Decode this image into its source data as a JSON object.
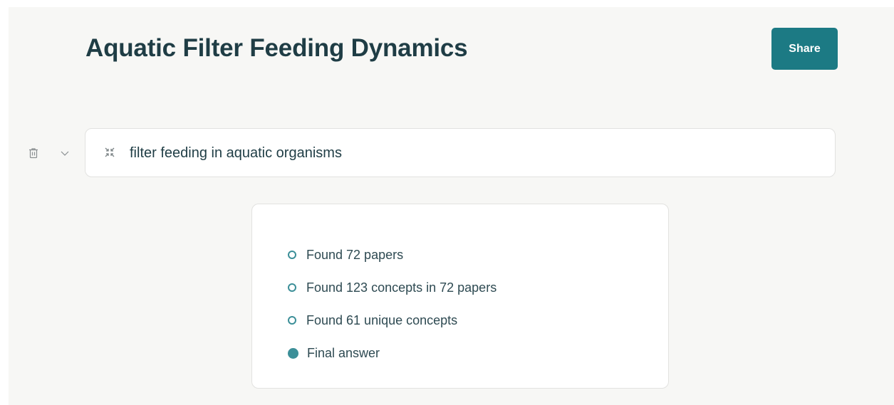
{
  "header": {
    "title": "Aquatic Filter Feeding Dynamics",
    "share_label": "Share"
  },
  "query": {
    "text": "filter feeding in aquatic organisms",
    "icon": "collapse-arrows-icon"
  },
  "row_tools": {
    "delete_icon": "trash-icon",
    "expand_icon": "chevron-down-icon"
  },
  "steps": [
    {
      "label": "Found 72 papers",
      "status": "pending"
    },
    {
      "label": "Found 123 concepts in 72 papers",
      "status": "pending"
    },
    {
      "label": "Found 61 unique concepts",
      "status": "pending"
    },
    {
      "label": "Final answer",
      "status": "done"
    }
  ],
  "colors": {
    "accent": "#1c7a84",
    "title": "#1f3d45",
    "step_dot": "#3c8f98",
    "background": "#f7f7f5"
  }
}
